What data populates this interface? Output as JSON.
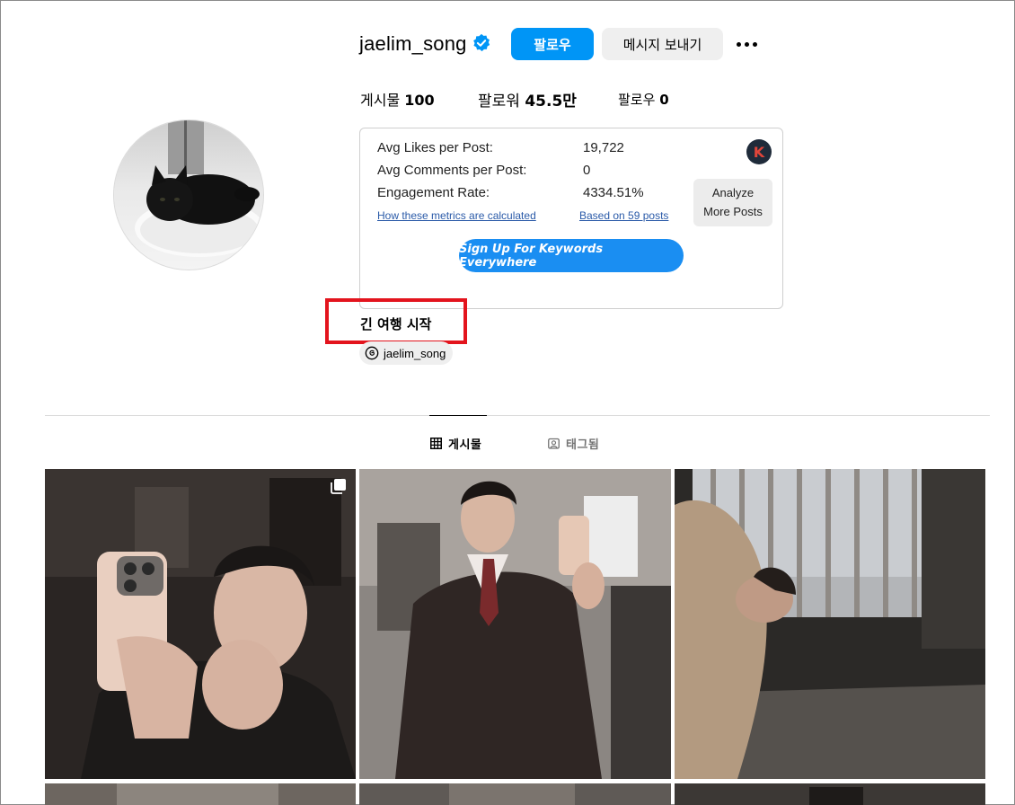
{
  "profile": {
    "username": "jaelim_song",
    "follow_label": "팔로우",
    "message_label": "메시지 보내기",
    "stats": {
      "posts_label": "게시물",
      "posts_value": "100",
      "followers_label": "팔로워",
      "followers_value": "45.5만",
      "following_label": "팔로우",
      "following_value": "0"
    },
    "bio": "긴 여행 시작",
    "threads_handle": "jaelim_song"
  },
  "extension": {
    "badge_letter": "K",
    "metrics": [
      {
        "label": "Avg Likes per Post:",
        "value": "19,722"
      },
      {
        "label": "Avg Comments per Post:",
        "value": "0"
      },
      {
        "label": "Engagement Rate:",
        "value": "4334.51%"
      }
    ],
    "how_link": "How these metrics are calculated",
    "based_link": "Based on 59 posts",
    "analyze_line1": "Analyze",
    "analyze_line2": "More Posts",
    "signup_label": "Sign Up For Keywords Everywhere"
  },
  "tabs": [
    {
      "label": "게시물",
      "icon": "grid-icon",
      "active": true
    },
    {
      "label": "태그됨",
      "icon": "tag-icon",
      "active": false
    }
  ],
  "colors": {
    "primary_blue": "#0095f6",
    "highlight_red": "#e3141d",
    "verified_blue": "#0095f6"
  }
}
